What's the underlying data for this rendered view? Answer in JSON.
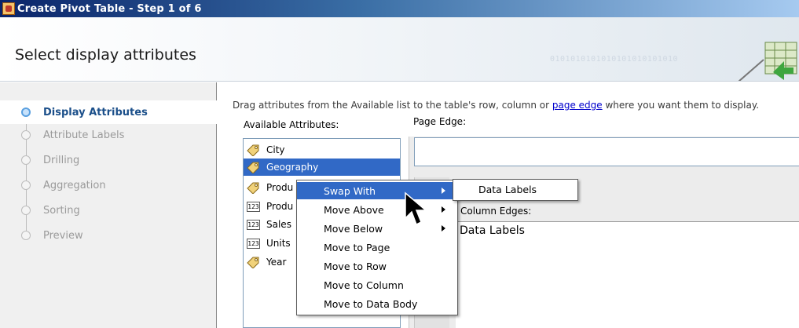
{
  "window": {
    "title": "Create Pivot Table - Step 1 of 6"
  },
  "header": {
    "title": "Select display attributes",
    "binary_text": "0101010101010101010101010"
  },
  "steps": [
    {
      "label": "Display Attributes",
      "active": true
    },
    {
      "label": "Attribute Labels",
      "active": false
    },
    {
      "label": "Drilling",
      "active": false
    },
    {
      "label": "Aggregation",
      "active": false
    },
    {
      "label": "Sorting",
      "active": false
    },
    {
      "label": "Preview",
      "active": false
    }
  ],
  "main": {
    "instructions_pre": "Drag attributes from the Available list to the table's row, column or ",
    "instructions_link": "page edge",
    "instructions_post": " where you want them to display.",
    "available_label": "Available Attributes:",
    "page_edge_label": "Page Edge:",
    "column_edges_label": "Column Edges:",
    "column_edges_value": "Data Labels",
    "available_items": [
      {
        "label": "City",
        "icon": "tag-icon"
      },
      {
        "label": "Geography",
        "icon": "tag-icon",
        "selected": true
      },
      {
        "label": "Produ",
        "icon": "tag-icon"
      },
      {
        "label": "Produ",
        "icon": "numeric-icon"
      },
      {
        "label": "Sales",
        "icon": "numeric-icon"
      },
      {
        "label": "Units",
        "icon": "numeric-icon"
      },
      {
        "label": "Year",
        "icon": "tag-icon"
      }
    ],
    "numeric_icon_text": "123"
  },
  "context_menu": {
    "items": [
      {
        "label": "Swap With",
        "submenu": true,
        "highlighted": true
      },
      {
        "label": "Move Above",
        "submenu": true
      },
      {
        "label": "Move Below",
        "submenu": true
      },
      {
        "label": "Move to Page"
      },
      {
        "label": "Move to Row"
      },
      {
        "label": "Move to Column"
      },
      {
        "label": "Move to Data Body"
      }
    ],
    "submenu_items": [
      {
        "label": "Data Labels"
      }
    ]
  },
  "colors": {
    "selection": "#3169c6",
    "link": "#0000cc",
    "active_step": "#1b4f8a"
  }
}
